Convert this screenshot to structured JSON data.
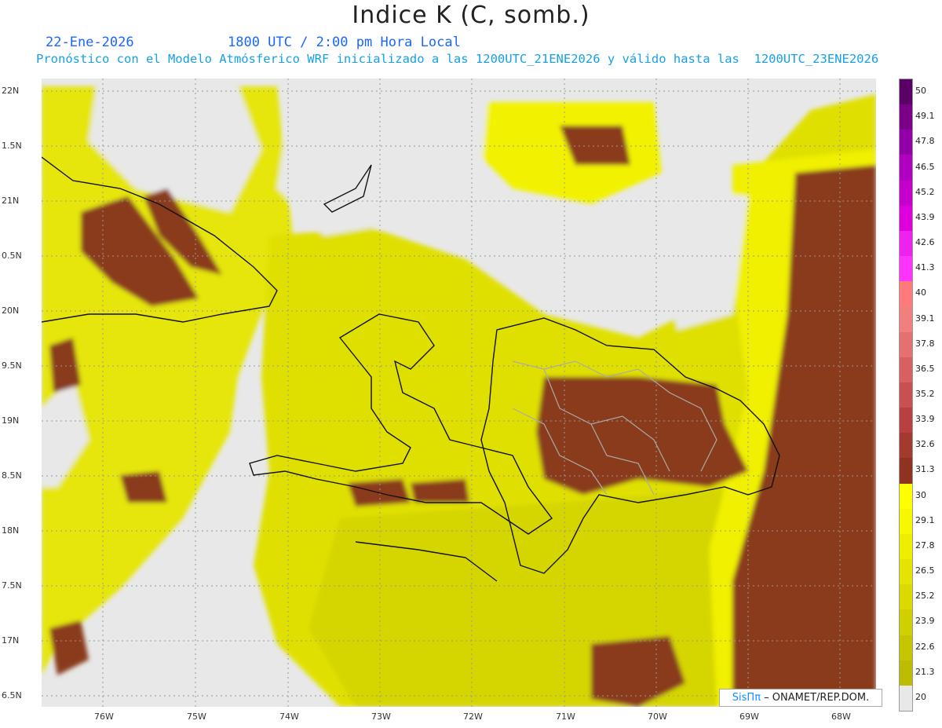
{
  "title": "Indice K (C, somb.)",
  "date_line": "22-Ene-2026",
  "time_line": "1800 UTC / 2:00 pm Hora Local",
  "model_line": "Pronóstico con el Modelo Atmósferico WRF inicializado a las 1200UTC_21ENE2026 y válido hasta las  1200UTC_23ENE2026",
  "lat_labels": [
    "22N",
    "1.5N",
    "21N",
    "0.5N",
    "20N",
    "9.5N",
    "19N",
    "8.5N",
    "18N",
    "7.5N",
    "17N",
    "6.5N"
  ],
  "lon_labels": [
    "76W",
    "75W",
    "74W",
    "73W",
    "72W",
    "71W",
    "70W",
    "69W",
    "68W"
  ],
  "legend": {
    "values": [
      "50",
      "49.1",
      "47.8",
      "46.5",
      "45.2",
      "43.9",
      "42.6",
      "41.3",
      "40",
      "39.1",
      "37.8",
      "36.5",
      "35.2",
      "33.9",
      "32.6",
      "31.3",
      "30",
      "29.1",
      "27.8",
      "26.5",
      "25.2",
      "23.9",
      "22.6",
      "21.3",
      "20"
    ],
    "colors": [
      "#5a0066",
      "#7a0088",
      "#9400a8",
      "#b000c0",
      "#c600cc",
      "#dd00dd",
      "#ee22ee",
      "#ff33ff",
      "#ff7a7a",
      "#f08080",
      "#e57070",
      "#d86060",
      "#c85050",
      "#b84040",
      "#a33a30",
      "#8e3320",
      "#ffff00",
      "#f7f700",
      "#eeee00",
      "#e4e400",
      "#dada00",
      "#d0d000",
      "#c6c600",
      "#bcbc00",
      "#e8e8e8"
    ]
  },
  "credit": {
    "brand": "SisПπ",
    "text": " – ONAMET/REP.DOM."
  }
}
